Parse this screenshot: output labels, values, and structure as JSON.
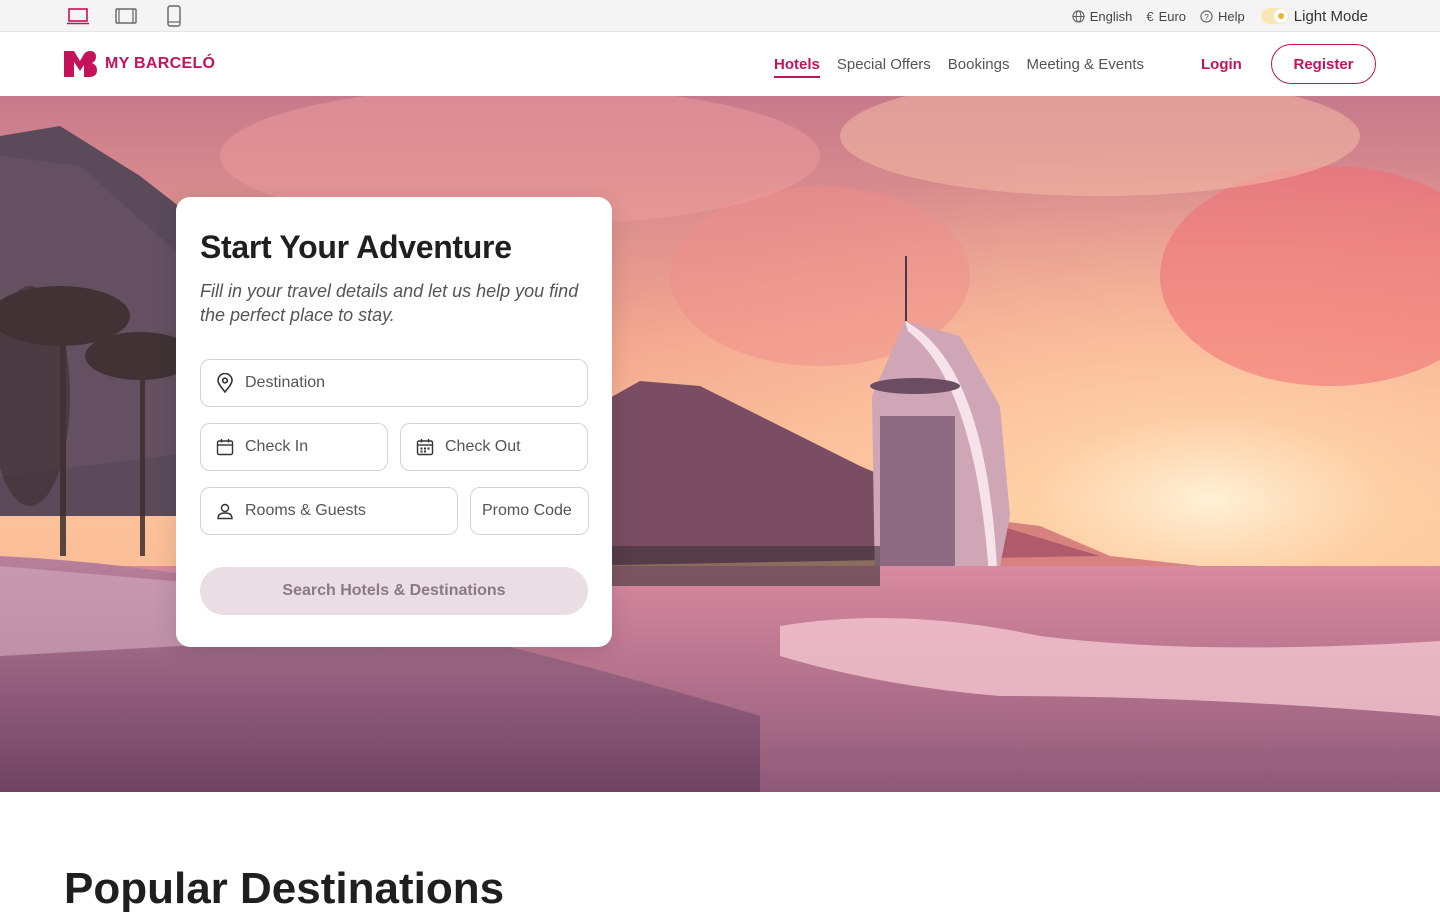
{
  "topbar": {
    "devices": [
      "desktop-view",
      "tablet-view",
      "mobile-view"
    ],
    "language": "English",
    "currency": "Euro",
    "help": "Help",
    "mode": "Light Mode"
  },
  "nav": {
    "brand": "MY BARCELÓ",
    "links": [
      "Hotels",
      "Special Offers",
      "Bookings",
      "Meeting & Events"
    ],
    "active_link": "Hotels",
    "login": "Login",
    "register": "Register"
  },
  "search_card": {
    "title": "Start Your Adventure",
    "subtitle": "Fill in your travel details and let us help you find the perfect place to stay.",
    "destination_placeholder": "Destination",
    "checkin_placeholder": "Check In",
    "checkout_placeholder": "Check Out",
    "rooms_placeholder": "Rooms & Guests",
    "promo_placeholder": "Promo Code",
    "search_button": "Search Hotels & Destinations"
  },
  "section": {
    "title": "Popular Destinations"
  },
  "colors": {
    "brand": "#c4125b",
    "button_disabled_bg": "#eadde4"
  }
}
